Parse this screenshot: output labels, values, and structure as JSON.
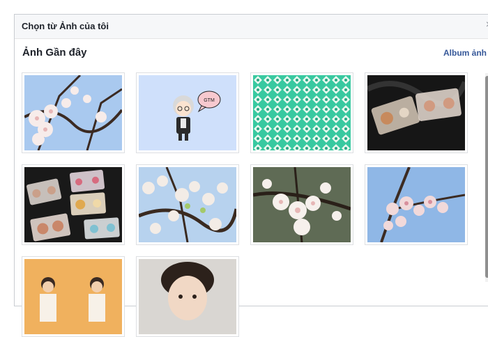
{
  "dialog": {
    "title": "Chọn từ Ảnh của tôi",
    "close_icon": "close-icon"
  },
  "section": {
    "title": "Ảnh Gần đây",
    "album_link": "Album ảnh"
  },
  "photos": [
    {
      "subject": "cherry-blossom",
      "caption": ""
    },
    {
      "subject": "cartoon-character",
      "caption": "GTM"
    },
    {
      "subject": "teal-pattern",
      "caption": ""
    },
    {
      "subject": "cassette-tapes",
      "caption": ""
    },
    {
      "subject": "cassette-tapes",
      "caption": ""
    },
    {
      "subject": "cherry-blossom",
      "caption": ""
    },
    {
      "subject": "cherry-blossom",
      "caption": ""
    },
    {
      "subject": "cherry-blossom",
      "caption": ""
    },
    {
      "subject": "group-photo",
      "caption": ""
    },
    {
      "subject": "portrait",
      "caption": ""
    }
  ],
  "colors": {
    "link": "#365899",
    "sky": "#9ec3ef",
    "blossom": "#f4e6e4",
    "teal": "#3ccfa5",
    "tape_bg": "#1a1a1a",
    "cartoon_bg": "#cfe0fb",
    "orange": "#f0b15e"
  }
}
